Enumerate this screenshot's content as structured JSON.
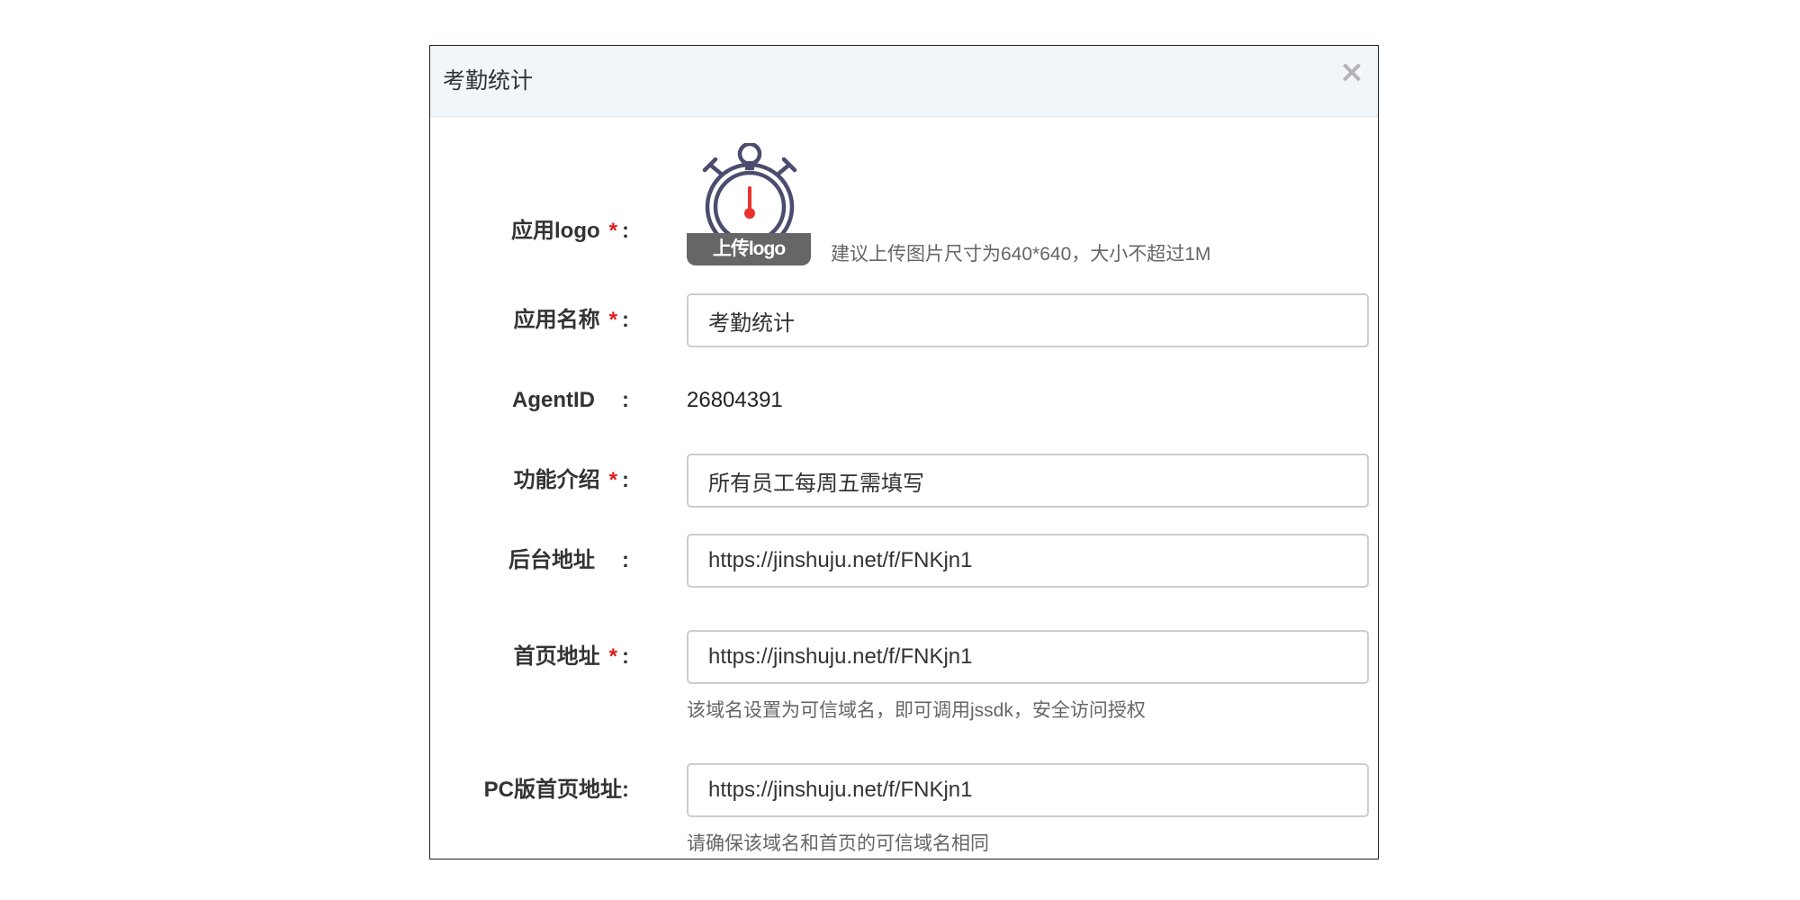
{
  "dialog": {
    "title": "考勤统计",
    "close_symbol": "×",
    "close_icon": "close-icon"
  },
  "form": {
    "logo": {
      "label": "应用logo",
      "required_mark": "*",
      "colon": ":",
      "upload_label": "上传logo",
      "hint": "建议上传图片尺寸为640*640，大小不超过1M",
      "icon": "stopwatch-icon",
      "icon_colors": {
        "outline": "#4b4c6e",
        "hand": "#e8322b"
      }
    },
    "app_name": {
      "label": "应用名称",
      "required_mark": "*",
      "colon": ":",
      "value": "考勤统计"
    },
    "agent_id": {
      "label": "AgentID",
      "colon": ":",
      "value": "26804391"
    },
    "intro": {
      "label": "功能介绍",
      "required_mark": "*",
      "colon": ":",
      "value": "所有员工每周五需填写"
    },
    "backend_url": {
      "label": "后台地址",
      "colon": ":",
      "value": "https://jinshuju.net/f/FNKjn1"
    },
    "home_url": {
      "label": "首页地址",
      "required_mark": "*",
      "colon": ":",
      "value": "https://jinshuju.net/f/FNKjn1",
      "hint": "该域名设置为可信域名，即可调用jssdk，安全访问授权"
    },
    "pc_home_url": {
      "label": "PC版首页地址:",
      "value": "https://jinshuju.net/f/FNKjn1",
      "hint": "请确保该域名和首页的可信域名相同"
    }
  },
  "colors": {
    "header_bg": "#f1f6fa",
    "required": "#e01b1b",
    "input_border": "#cdcdcd",
    "upload_bg": "#666666"
  }
}
